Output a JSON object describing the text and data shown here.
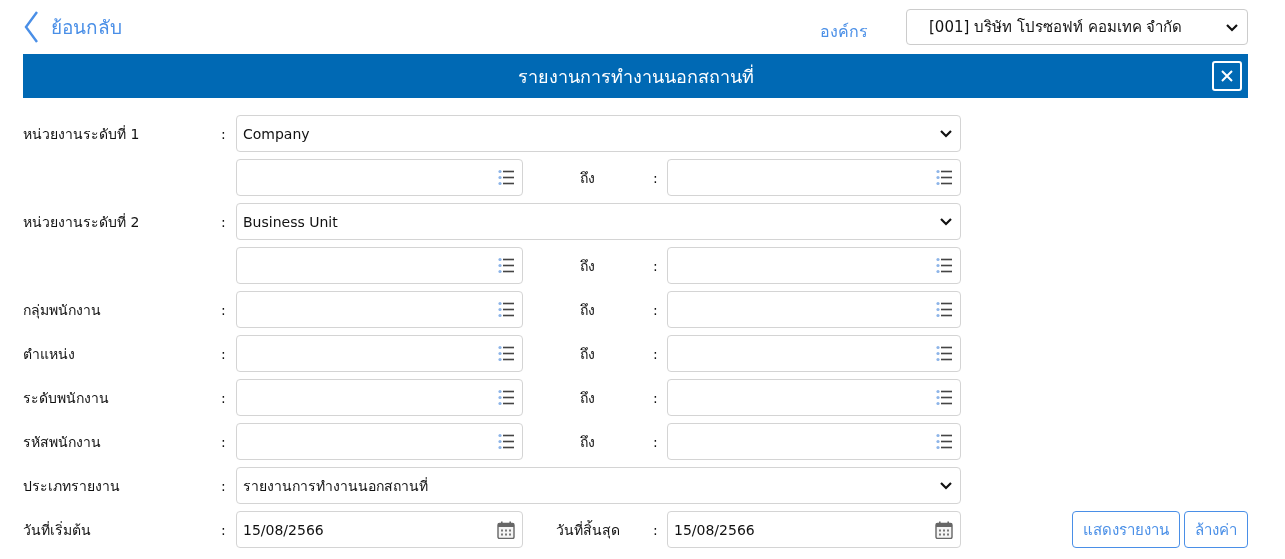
{
  "back_link": {
    "label": "ย้อนกลับ"
  },
  "organization": {
    "label": "องค์กร",
    "value": "[001] บริษัท โปรซอฟท์ คอมเทค จำกัด"
  },
  "header": {
    "title": "รายงานการทำงานนอกสถานที่"
  },
  "rows": [
    {
      "kind": "select",
      "label": "หน่วยงานระดับที่ 1",
      "colon": ":",
      "value": "Company"
    },
    {
      "kind": "range",
      "to_label": "ถึง",
      "to_colon": ":"
    },
    {
      "kind": "select",
      "label": "หน่วยงานระดับที่ 2",
      "colon": ":",
      "value": "Business Unit"
    },
    {
      "kind": "range",
      "to_label": "ถึง",
      "to_colon": ":"
    },
    {
      "kind": "range",
      "label": "กลุ่มพนักงาน",
      "colon": ":",
      "to_label": "ถึง",
      "to_colon": ":"
    },
    {
      "kind": "range",
      "label": "ตำแหน่ง",
      "colon": ":",
      "to_label": "ถึง",
      "to_colon": ":"
    },
    {
      "kind": "range",
      "label": "ระดับพนักงาน",
      "colon": ":",
      "to_label": "ถึง",
      "to_colon": ":"
    },
    {
      "kind": "range",
      "label": "รหัสพนักงาน",
      "colon": ":",
      "to_label": "ถึง",
      "to_colon": ":"
    },
    {
      "kind": "select",
      "label": "ประเภทรายงาน",
      "colon": ":",
      "value": "รายงานการทำงานนอกสถานที่"
    },
    {
      "kind": "date_range",
      "label": "วันที่เริ่มต้น",
      "colon": ":",
      "from": "15/08/2566",
      "to_label": "วันที่สิ้นสุด",
      "to_colon": ":",
      "to": "15/08/2566"
    }
  ],
  "buttons": [
    "แสดงรายงาน",
    "ล้างค่า"
  ]
}
